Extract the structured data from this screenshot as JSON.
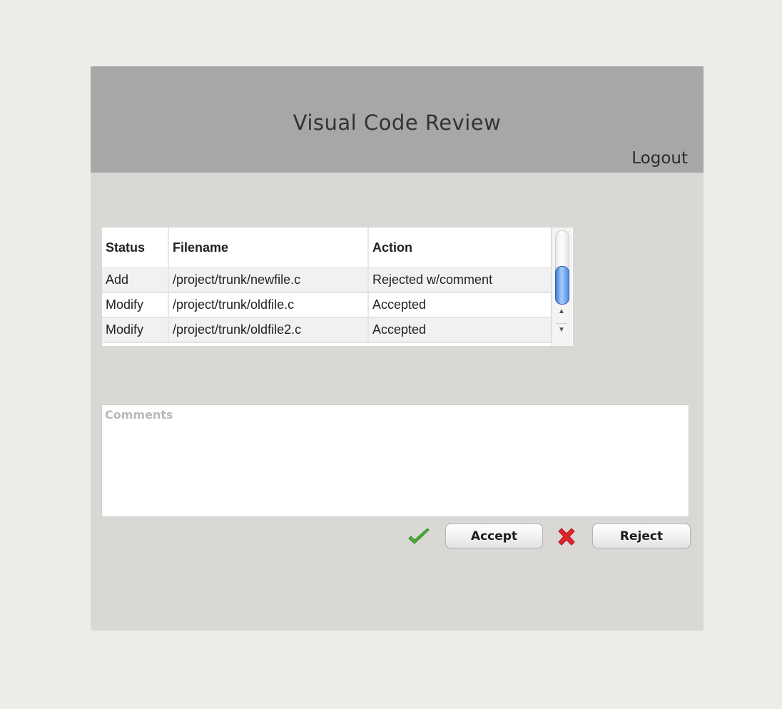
{
  "header": {
    "title": "Visual Code Review",
    "logout_label": "Logout"
  },
  "file_table": {
    "columns": [
      "Status",
      "Filename",
      "Action"
    ],
    "rows": [
      {
        "status": "Add",
        "filename": "/project/trunk/newfile.c",
        "action": "Rejected w/comment"
      },
      {
        "status": "Modify",
        "filename": "/project/trunk/oldfile.c",
        "action": "Accepted"
      },
      {
        "status": "Modify",
        "filename": "/project/trunk/oldfile2.c",
        "action": "Accepted"
      }
    ]
  },
  "comments": {
    "placeholder": "Comments",
    "value": ""
  },
  "actions": {
    "accept_label": "Accept",
    "reject_label": "Reject",
    "accept_icon": "check-icon",
    "reject_icon": "cross-icon"
  },
  "colors": {
    "header_bg": "#a7a7a7",
    "panel_bg": "#d9d8d5",
    "accept_green": "#4caf35",
    "reject_red": "#e0242b",
    "scroll_thumb_blue": "#3d7bd6"
  }
}
